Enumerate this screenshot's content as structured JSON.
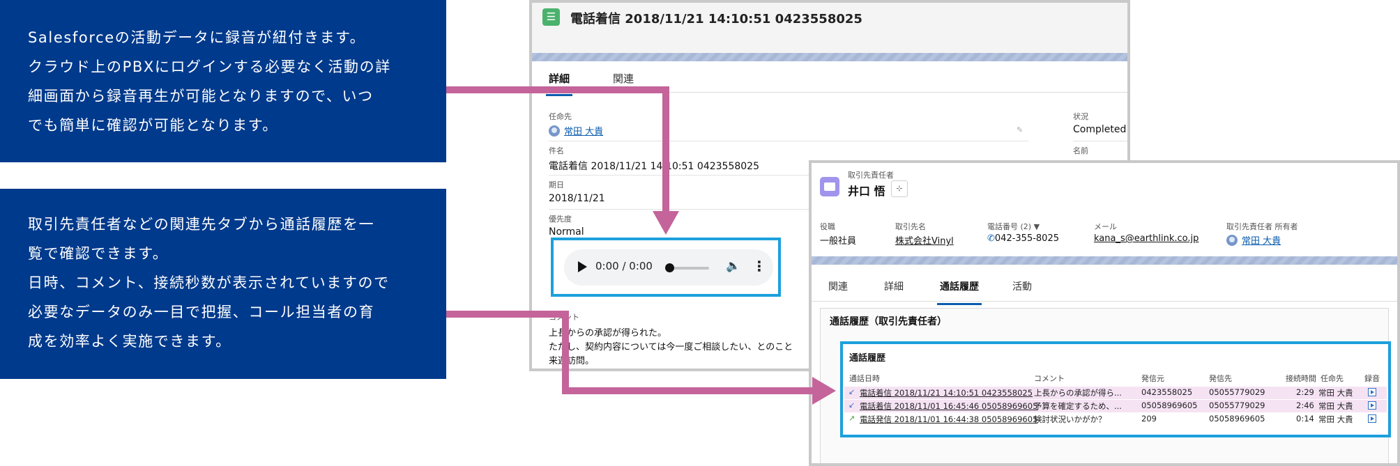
{
  "explanations": {
    "box1": [
      "Salesforceの活動データに録音が紐付きます。",
      "クラウド上のPBXにログインする必要なく活動の詳",
      "細画面から録音再生が可能となりますので、いつ",
      "でも簡単に確認が可能となります。"
    ],
    "box2": [
      "取引先責任者などの関連先タブから通話履歴を一",
      "覧で確認できます。",
      "日時、コメント、接続秒数が表示されていますので",
      "必要なデータのみ一目で把握、コール担当者の育",
      "成を効率よく実施できます。"
    ]
  },
  "activity": {
    "title": "電話着信 2018/11/21 14:10:51 0423558025",
    "tabs": [
      "詳細",
      "関連"
    ],
    "assignee_label": "任命先",
    "assignee": "常田 大貴",
    "subject_label": "件名",
    "subject": "電話着信 2018/11/21 14:10:51 0423558025",
    "due_label": "期日",
    "due": "2018/11/21",
    "priority_label": "優先度",
    "priority": "Normal",
    "status_label": "状況",
    "status": "Completed",
    "name_label": "名前",
    "comment_label": "コメント",
    "comment_lines": [
      "上長からの承認が得られた。",
      "ただし、契約内容については今一度ご相談したい、とのこと",
      "来週訪問。"
    ]
  },
  "audio": {
    "time": "0:00 / 0:00",
    "progress": 0
  },
  "contact": {
    "type": "取引先責任者",
    "name": "井口 悟",
    "fields": [
      {
        "label": "役職",
        "value": "一般社員"
      },
      {
        "label": "取引先名",
        "value": "株式会社Vinyl"
      },
      {
        "label": "電話番号 (2) ▼",
        "value": "042-355-8025"
      },
      {
        "label": "メール",
        "value": "kana_s@earthlink.co.jp"
      },
      {
        "label": "取引先責任者 所有者",
        "value": "常田 大貴"
      }
    ],
    "tabs": [
      "関連",
      "詳細",
      "通話履歴",
      "活動"
    ],
    "card_title": "通話履歴（取引先責任者）",
    "log_title": "通話履歴",
    "columns": [
      "通話日時",
      "コメント",
      "発信元",
      "発信先",
      "接続時間",
      "任命先",
      "録音"
    ],
    "rows": [
      {
        "subject": "電話着信 2018/11/21 14:10:51 0423558025",
        "comment": "上長からの承認が得ら...",
        "from": "0423558025",
        "to": "05055779029",
        "duration": "2:29",
        "assignee": "常田 大貴"
      },
      {
        "subject": "電話着信 2018/11/01 16:45:46 05058969605",
        "comment": "予算を確定するため、...",
        "from": "05058969605",
        "to": "05055779029",
        "duration": "2:46",
        "assignee": "常田 大貴"
      },
      {
        "subject": "電話発信 2018/11/01 16:44:38 05058969605",
        "comment": "検討状況いかがか？",
        "from": "209",
        "to": "05058969605",
        "duration": "0:14",
        "assignee": "常田 大貴"
      }
    ]
  },
  "colors": {
    "explanation_bg": "#003a8c",
    "highlight_border": "#1ca0dc",
    "arrow": "#c4649a",
    "row_highlight": "#f5e3f4",
    "link": "#0b5cad"
  }
}
